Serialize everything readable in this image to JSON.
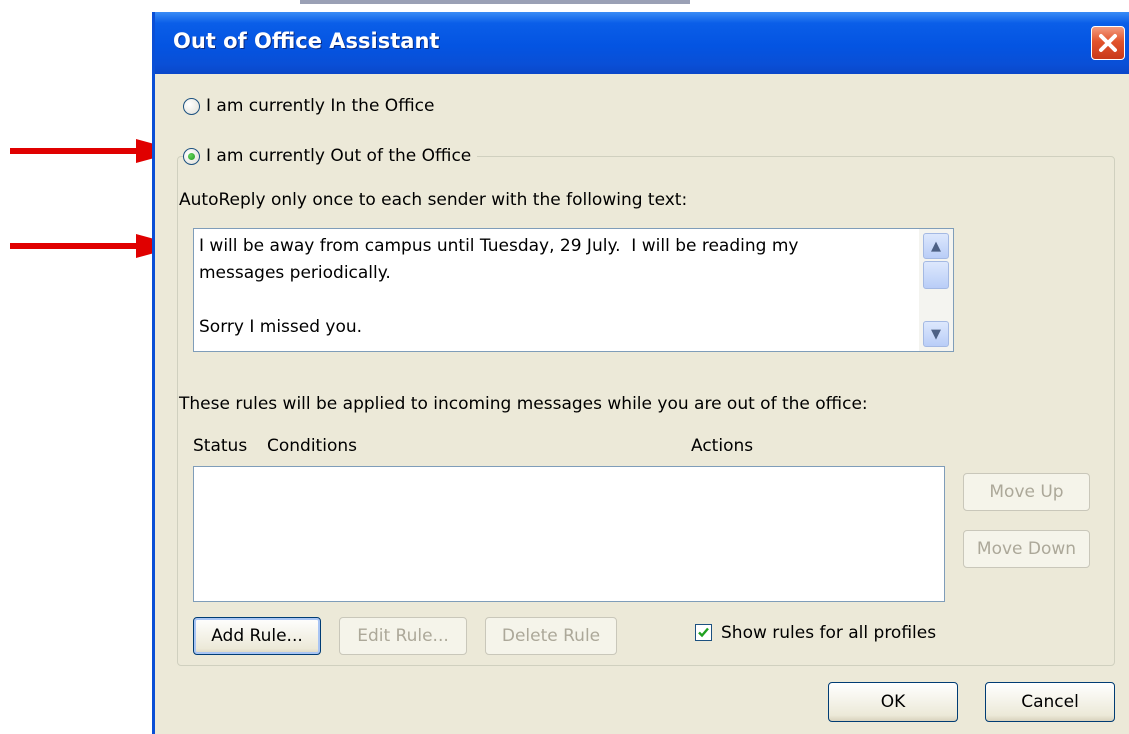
{
  "dialog": {
    "title": "Out of Office Assistant",
    "close_icon": "close-x-icon"
  },
  "status": {
    "in_office_label": "I am currently In the Office",
    "out_office_label": "I am currently Out of the Office",
    "selected": "out_office"
  },
  "autoreply": {
    "label": "AutoReply only once to each sender with the following text:",
    "text": "I will be away from campus until Tuesday, 29 July.  I will be reading my\nmessages periodically.\n\nSorry I missed you."
  },
  "rules": {
    "intro": "These rules will be applied to incoming messages while you are out of the office:",
    "columns": [
      "Status",
      "Conditions",
      "Actions"
    ],
    "rows": [],
    "move_up_label": "Move Up",
    "move_down_label": "Move Down",
    "add_rule_label": "Add Rule...",
    "edit_rule_label": "Edit Rule...",
    "delete_rule_label": "Delete Rule",
    "show_all_profiles_label": "Show rules for all profiles",
    "show_all_profiles_checked": true
  },
  "footer": {
    "ok_label": "OK",
    "cancel_label": "Cancel"
  },
  "colors": {
    "arrow": "#e00000",
    "titlebar": "#0a4fd6",
    "dialog_bg": "#ece9d8",
    "radio_selected": "#239b22"
  }
}
